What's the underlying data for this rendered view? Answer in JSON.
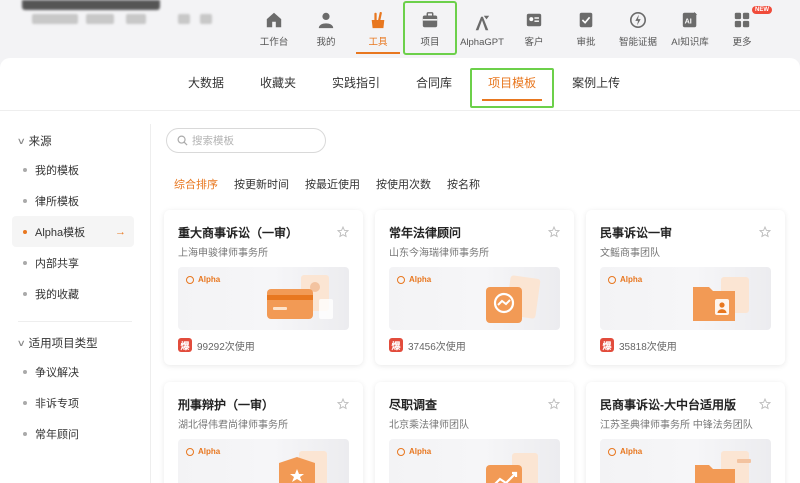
{
  "topnav": {
    "items": [
      {
        "label": "工作台",
        "icon": "home-icon"
      },
      {
        "label": "我的",
        "icon": "user-icon"
      },
      {
        "label": "工具",
        "icon": "tools-icon",
        "active": true
      },
      {
        "label": "项目",
        "icon": "briefcase-icon",
        "highlighted": true
      },
      {
        "label": "AlphaGPT",
        "icon": "alphagpt-icon"
      },
      {
        "label": "客户",
        "icon": "client-card-icon"
      },
      {
        "label": "审批",
        "icon": "approval-icon"
      },
      {
        "label": "智能证据",
        "icon": "evidence-icon"
      },
      {
        "label": "AI知识库",
        "icon": "ai-knowledge-icon"
      },
      {
        "label": "更多",
        "icon": "more-grid-icon",
        "badge": "NEW"
      }
    ]
  },
  "subtabs": [
    {
      "label": "大数据"
    },
    {
      "label": "收藏夹"
    },
    {
      "label": "实践指引"
    },
    {
      "label": "合同库"
    },
    {
      "label": "项目模板",
      "active": true
    },
    {
      "label": "案例上传"
    }
  ],
  "sidebar": {
    "section1": {
      "title": "来源",
      "items": [
        {
          "label": "我的模板"
        },
        {
          "label": "律所模板"
        },
        {
          "label": "Alpha模板",
          "active": true
        },
        {
          "label": "内部共享"
        },
        {
          "label": "我的收藏"
        }
      ]
    },
    "section2": {
      "title": "适用项目类型",
      "items": [
        {
          "label": "争议解决"
        },
        {
          "label": "非诉专项"
        },
        {
          "label": "常年顾问"
        }
      ]
    }
  },
  "search": {
    "placeholder": "搜索模板"
  },
  "sorts": [
    {
      "label": "综合排序",
      "active": true
    },
    {
      "label": "按更新时间"
    },
    {
      "label": "按最近使用"
    },
    {
      "label": "按使用次数"
    },
    {
      "label": "按名称"
    }
  ],
  "cards": [
    {
      "title": "重大商事诉讼（一审）",
      "firm": "上海申骏律师事务所",
      "brand": "Alpha",
      "hot": "爆",
      "usage": "99292次使用",
      "illustration": "card-doc"
    },
    {
      "title": "常年法律顾问",
      "firm": "山东今海瑞律师事务所",
      "brand": "Alpha",
      "hot": "爆",
      "usage": "37456次使用",
      "illustration": "handshake-doc"
    },
    {
      "title": "民事诉讼一审",
      "firm": "文鳐商事团队",
      "brand": "Alpha",
      "hot": "爆",
      "usage": "35818次使用",
      "illustration": "user-folder"
    },
    {
      "title": "刑事辩护（一审）",
      "firm": "湖北得伟君尚律师事务所",
      "brand": "Alpha",
      "illustration": "shield-star"
    },
    {
      "title": "尽职调查",
      "firm": "北京乘法律师团队",
      "brand": "Alpha",
      "illustration": "chart-doc"
    },
    {
      "title": "民商事诉讼-大中台适用版",
      "firm": "江苏圣典律师事务所 中锋法务团队",
      "brand": "Alpha",
      "illustration": "folder-doc"
    }
  ],
  "colors": {
    "accent": "#e8771f",
    "highlight": "#6cd04a",
    "hot": "#e24c3c"
  }
}
